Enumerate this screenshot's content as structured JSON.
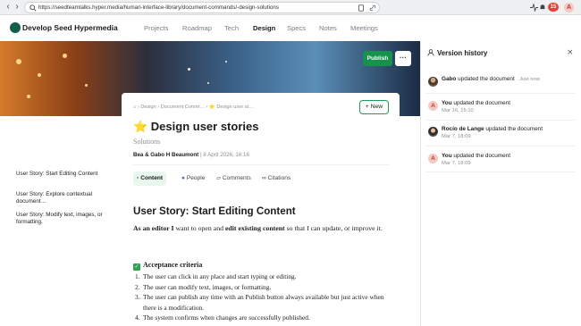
{
  "browser": {
    "url": "https://seedteamtalks.hyper.media/human-interface-library/document-commands/-design-solutions",
    "notification_count": "15",
    "avatar_letter": "A"
  },
  "site": {
    "title": "Develop Seed Hypermedia",
    "nav": [
      "Projects",
      "Roadmap",
      "Tech",
      "Design",
      "Specs",
      "Notes",
      "Meetings"
    ],
    "active_nav": "Design"
  },
  "toolbar": {
    "publish_label": "Publish",
    "more_label": "···",
    "new_label": "+ New"
  },
  "document": {
    "breadcrumb": "⌂  ›  Design  ›  Document Comm…  ›  ⭐ Design user st…",
    "title": "⭐ Design user stories",
    "subtitle": "Solutions",
    "author": "Bea & Gabo H Beaumont",
    "date": "8 April 2026, 16:16",
    "tabs": [
      "Content",
      "People",
      "Comments",
      "Citations"
    ],
    "active_tab": "Content",
    "heading": "User Story: Start Editing Content",
    "para_bold_1": "As an editor I",
    "para_text_1": " want to open and ",
    "para_bold_2": "edit existing content",
    "para_text_2": " so that I can update, or improve it.",
    "criteria_title": "Acceptance criteria",
    "criteria": [
      "The user can click in any place and start typing or editing.",
      "The user can modify text, images, or formatting.",
      "The user can publish any time with an Publish button always available but just active when there is a modification.",
      "The system confirms when changes are successfully published."
    ]
  },
  "toc": [
    "User Story: Start Editing Content",
    "User Story: Explore contextual document…",
    "User Story: Modify text, images, or formatting."
  ],
  "version_history": {
    "title": "Version history",
    "entries": [
      {
        "who": "Gabo",
        "action": " updated the document",
        "time": "Just now",
        "avatar": "photo"
      },
      {
        "who": "You",
        "action": " updated the document",
        "time": "Mar 16, 15:10",
        "avatar": "letter"
      },
      {
        "who": "Rocío de Lange",
        "action": " updated the document",
        "time": "Mar 7, 18:09",
        "avatar": "photo2"
      },
      {
        "who": "You",
        "action": " updated the document",
        "time": "Mar 7, 18:09",
        "avatar": "letter"
      }
    ]
  },
  "colors": {
    "accent_green": "#17924d",
    "notification_red": "#e0463c"
  }
}
